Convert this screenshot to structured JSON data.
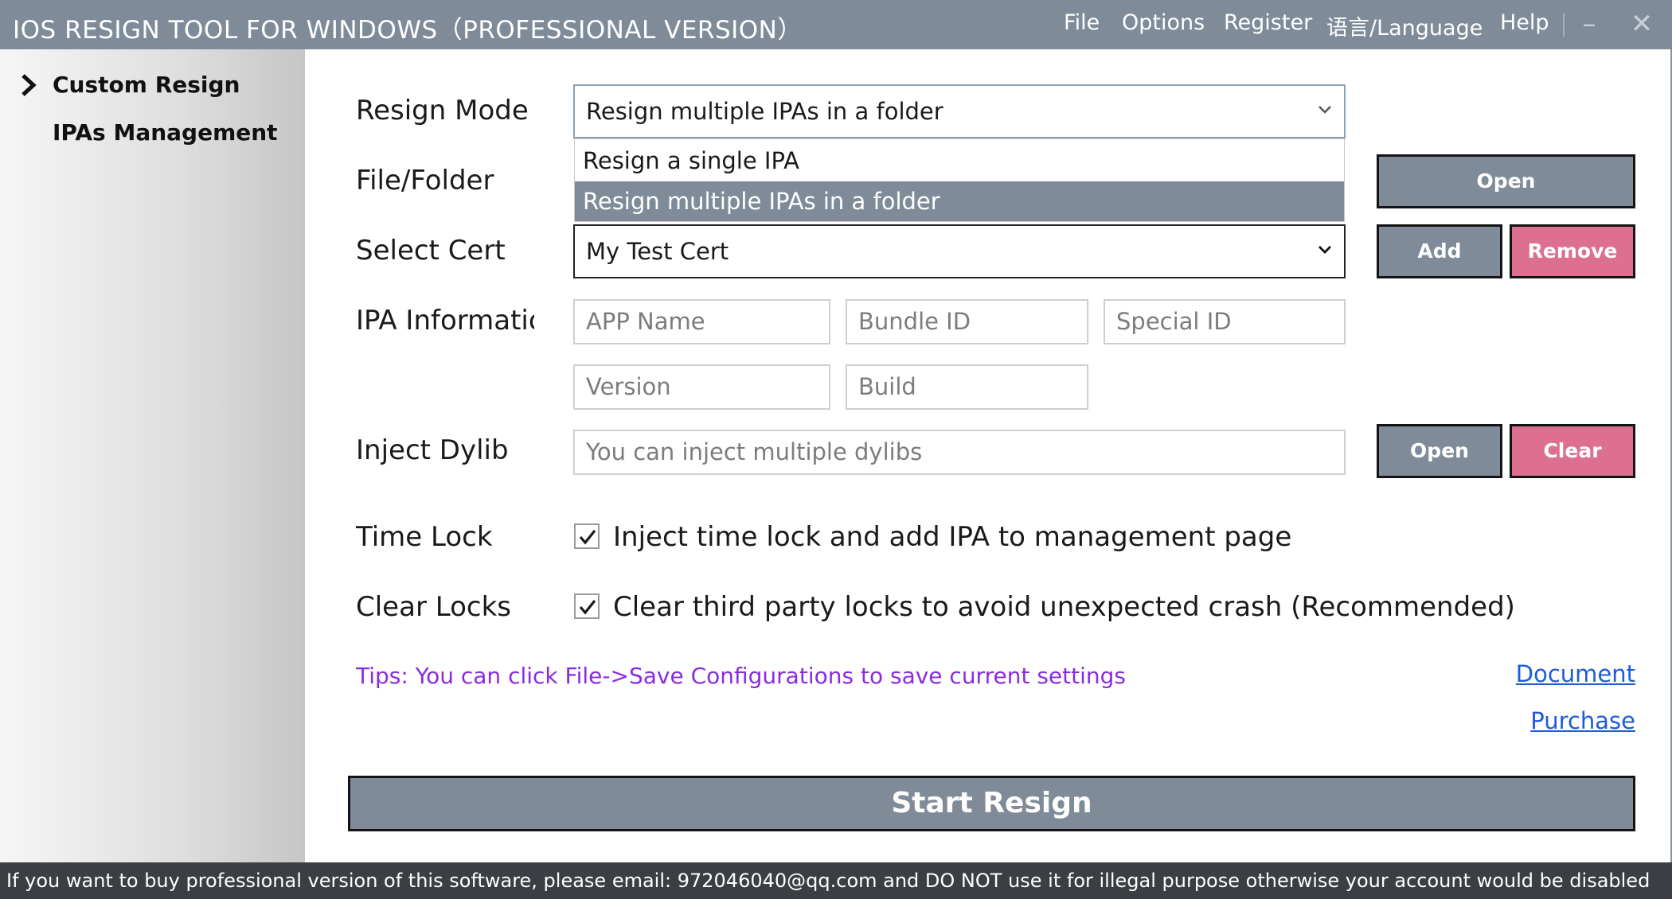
{
  "window": {
    "title": "IOS RESIGN TOOL FOR WINDOWS（PROFESSIONAL VERSION）",
    "menu": [
      "File",
      "Options",
      "Register",
      "语言/Language",
      "Help"
    ],
    "minimize_glyph": "–",
    "close_glyph": "✕"
  },
  "sidebar": {
    "items": [
      {
        "label": "Custom Resign",
        "selected": true
      },
      {
        "label": "IPAs Management",
        "selected": false
      }
    ]
  },
  "form": {
    "labels": {
      "resign_mode": "Resign Mode",
      "file_folder": "File/Folder",
      "select_cert": "Select Cert",
      "ipa_info": "IPA Informatio",
      "inject_dylib": "Inject Dylib",
      "time_lock": "Time Lock",
      "clear_locks": "Clear Locks"
    },
    "resign_mode": {
      "value": "Resign multiple IPAs in a folder",
      "options": [
        "Resign a single IPA",
        "Resign multiple IPAs in a folder"
      ],
      "expanded": true
    },
    "file_folder": {
      "open_label": "Open"
    },
    "cert": {
      "value": "My Test Cert",
      "add_label": "Add",
      "remove_label": "Remove"
    },
    "ipa_info": {
      "app_name_placeholder": "APP Name",
      "bundle_id_placeholder": "Bundle ID",
      "special_id_placeholder": "Special ID",
      "version_placeholder": "Version",
      "build_placeholder": "Build"
    },
    "dylib": {
      "placeholder": "You can inject multiple dylibs",
      "open_label": "Open",
      "clear_label": "Clear"
    },
    "time_lock": {
      "checked": true,
      "text": "Inject time lock and add IPA to management page"
    },
    "clear_locks": {
      "checked": true,
      "text": "Clear third party locks to avoid unexpected crash (Recommended)"
    }
  },
  "tips": "Tips: You can click File->Save Configurations to save current settings",
  "links": {
    "document": "Document",
    "purchase": "Purchase"
  },
  "start_button": "Start Resign",
  "status_bar": "If you want to buy professional version of this software, please email: 972046040@qq.com and DO NOT use it for illegal purpose otherwise your account would be disabled",
  "colors": {
    "accent_gray": "#7f8b99",
    "danger_pink": "#dd6f91",
    "tips_purple": "#8a2be2",
    "link_blue": "#1e5bd9",
    "status_bg": "#3b3f44"
  }
}
